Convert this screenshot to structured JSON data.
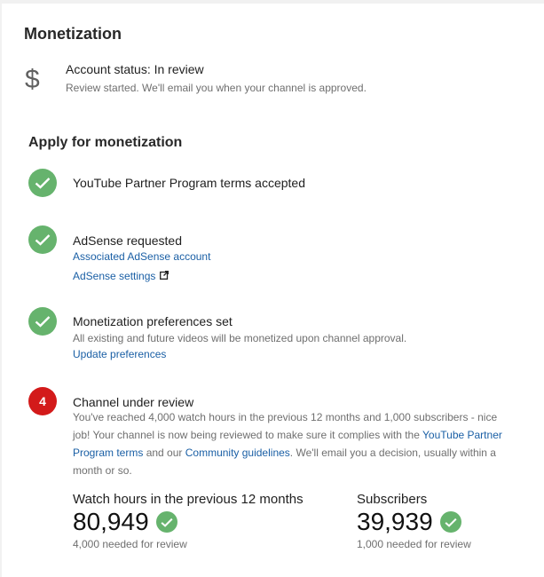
{
  "page": {
    "title": "Monetization"
  },
  "account": {
    "icon": "dollar-icon",
    "status": "Account status: In review",
    "detail": "Review started. We'll email you when your channel is approved."
  },
  "apply": {
    "title": "Apply for monetization",
    "steps": [
      {
        "state": "done",
        "title": "YouTube Partner Program terms accepted"
      },
      {
        "state": "done",
        "title": "AdSense requested",
        "links": [
          "Associated AdSense account",
          "AdSense settings"
        ]
      },
      {
        "state": "done",
        "title": "Monetization preferences set",
        "detail": "All existing and future videos will be monetized upon channel approval.",
        "link": "Update preferences"
      },
      {
        "state": "pending",
        "number": "4",
        "title": "Channel under review",
        "desc_parts": [
          "You've reached 4,000 watch hours in the previous 12 months and 1,000 subscribers - nice job! Your channel is now being reviewed to make sure it complies with the ",
          "YouTube Partner Program terms",
          " and our ",
          "Community guidelines",
          ". We'll email you a decision, usually within a month or so."
        ]
      }
    ]
  },
  "stats": {
    "watch_hours": {
      "label": "Watch hours in the previous 12 months",
      "value": "80,949",
      "note": "4,000 needed for review"
    },
    "subscribers": {
      "label": "Subscribers",
      "value": "39,939",
      "note": "1,000 needed for review"
    }
  },
  "colors": {
    "check": "#66b36d",
    "pending": "#d31a1a",
    "link": "#1a5fa5"
  }
}
